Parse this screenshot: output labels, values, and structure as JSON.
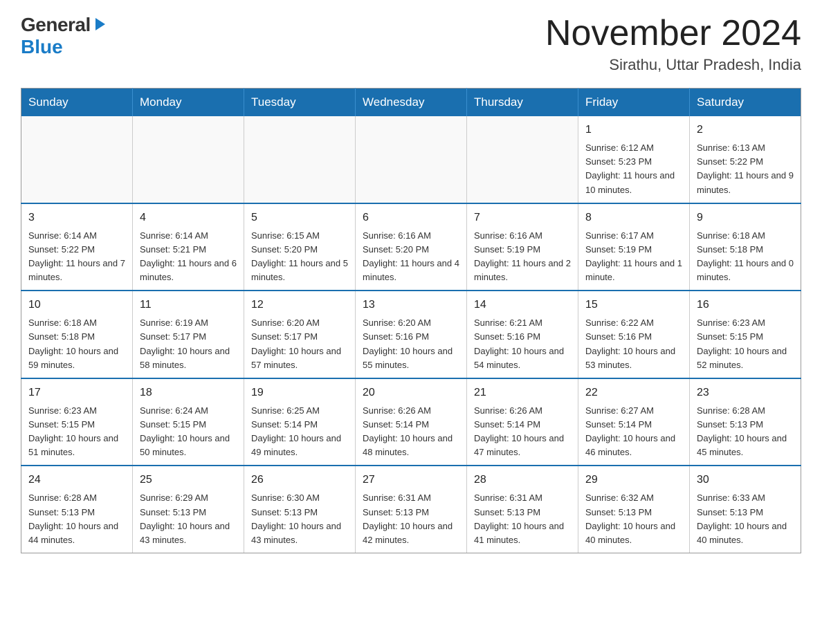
{
  "header": {
    "logo_general": "General",
    "logo_blue": "Blue",
    "month_title": "November 2024",
    "location": "Sirathu, Uttar Pradesh, India"
  },
  "weekdays": [
    "Sunday",
    "Monday",
    "Tuesday",
    "Wednesday",
    "Thursday",
    "Friday",
    "Saturday"
  ],
  "weeks": [
    [
      {
        "day": "",
        "info": ""
      },
      {
        "day": "",
        "info": ""
      },
      {
        "day": "",
        "info": ""
      },
      {
        "day": "",
        "info": ""
      },
      {
        "day": "",
        "info": ""
      },
      {
        "day": "1",
        "info": "Sunrise: 6:12 AM\nSunset: 5:23 PM\nDaylight: 11 hours and 10 minutes."
      },
      {
        "day": "2",
        "info": "Sunrise: 6:13 AM\nSunset: 5:22 PM\nDaylight: 11 hours and 9 minutes."
      }
    ],
    [
      {
        "day": "3",
        "info": "Sunrise: 6:14 AM\nSunset: 5:22 PM\nDaylight: 11 hours and 7 minutes."
      },
      {
        "day": "4",
        "info": "Sunrise: 6:14 AM\nSunset: 5:21 PM\nDaylight: 11 hours and 6 minutes."
      },
      {
        "day": "5",
        "info": "Sunrise: 6:15 AM\nSunset: 5:20 PM\nDaylight: 11 hours and 5 minutes."
      },
      {
        "day": "6",
        "info": "Sunrise: 6:16 AM\nSunset: 5:20 PM\nDaylight: 11 hours and 4 minutes."
      },
      {
        "day": "7",
        "info": "Sunrise: 6:16 AM\nSunset: 5:19 PM\nDaylight: 11 hours and 2 minutes."
      },
      {
        "day": "8",
        "info": "Sunrise: 6:17 AM\nSunset: 5:19 PM\nDaylight: 11 hours and 1 minute."
      },
      {
        "day": "9",
        "info": "Sunrise: 6:18 AM\nSunset: 5:18 PM\nDaylight: 11 hours and 0 minutes."
      }
    ],
    [
      {
        "day": "10",
        "info": "Sunrise: 6:18 AM\nSunset: 5:18 PM\nDaylight: 10 hours and 59 minutes."
      },
      {
        "day": "11",
        "info": "Sunrise: 6:19 AM\nSunset: 5:17 PM\nDaylight: 10 hours and 58 minutes."
      },
      {
        "day": "12",
        "info": "Sunrise: 6:20 AM\nSunset: 5:17 PM\nDaylight: 10 hours and 57 minutes."
      },
      {
        "day": "13",
        "info": "Sunrise: 6:20 AM\nSunset: 5:16 PM\nDaylight: 10 hours and 55 minutes."
      },
      {
        "day": "14",
        "info": "Sunrise: 6:21 AM\nSunset: 5:16 PM\nDaylight: 10 hours and 54 minutes."
      },
      {
        "day": "15",
        "info": "Sunrise: 6:22 AM\nSunset: 5:16 PM\nDaylight: 10 hours and 53 minutes."
      },
      {
        "day": "16",
        "info": "Sunrise: 6:23 AM\nSunset: 5:15 PM\nDaylight: 10 hours and 52 minutes."
      }
    ],
    [
      {
        "day": "17",
        "info": "Sunrise: 6:23 AM\nSunset: 5:15 PM\nDaylight: 10 hours and 51 minutes."
      },
      {
        "day": "18",
        "info": "Sunrise: 6:24 AM\nSunset: 5:15 PM\nDaylight: 10 hours and 50 minutes."
      },
      {
        "day": "19",
        "info": "Sunrise: 6:25 AM\nSunset: 5:14 PM\nDaylight: 10 hours and 49 minutes."
      },
      {
        "day": "20",
        "info": "Sunrise: 6:26 AM\nSunset: 5:14 PM\nDaylight: 10 hours and 48 minutes."
      },
      {
        "day": "21",
        "info": "Sunrise: 6:26 AM\nSunset: 5:14 PM\nDaylight: 10 hours and 47 minutes."
      },
      {
        "day": "22",
        "info": "Sunrise: 6:27 AM\nSunset: 5:14 PM\nDaylight: 10 hours and 46 minutes."
      },
      {
        "day": "23",
        "info": "Sunrise: 6:28 AM\nSunset: 5:13 PM\nDaylight: 10 hours and 45 minutes."
      }
    ],
    [
      {
        "day": "24",
        "info": "Sunrise: 6:28 AM\nSunset: 5:13 PM\nDaylight: 10 hours and 44 minutes."
      },
      {
        "day": "25",
        "info": "Sunrise: 6:29 AM\nSunset: 5:13 PM\nDaylight: 10 hours and 43 minutes."
      },
      {
        "day": "26",
        "info": "Sunrise: 6:30 AM\nSunset: 5:13 PM\nDaylight: 10 hours and 43 minutes."
      },
      {
        "day": "27",
        "info": "Sunrise: 6:31 AM\nSunset: 5:13 PM\nDaylight: 10 hours and 42 minutes."
      },
      {
        "day": "28",
        "info": "Sunrise: 6:31 AM\nSunset: 5:13 PM\nDaylight: 10 hours and 41 minutes."
      },
      {
        "day": "29",
        "info": "Sunrise: 6:32 AM\nSunset: 5:13 PM\nDaylight: 10 hours and 40 minutes."
      },
      {
        "day": "30",
        "info": "Sunrise: 6:33 AM\nSunset: 5:13 PM\nDaylight: 10 hours and 40 minutes."
      }
    ]
  ]
}
